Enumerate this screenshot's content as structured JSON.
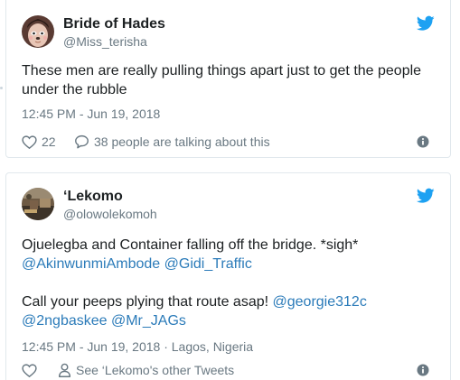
{
  "tweets": [
    {
      "display_name": "Bride of Hades",
      "handle": "@Miss_terisha",
      "text": "These men are really pulling things apart just to get the people under the rubble",
      "timestamp": "12:45 PM - Jun 19, 2018",
      "like_count": "22",
      "reply_label": "38 people are talking about this"
    },
    {
      "display_name": "‘Lekomo",
      "handle": "@olowolekomoh",
      "line1_text": "Ojuelegba and Container falling off the bridge. *sigh*",
      "line2_mention1": "@AkinwunmiAmbode",
      "line2_mention2": "@Gidi_Traffic",
      "line3_text": "Call your peeps plying that route asap!",
      "line3_mention": "@georgie312c",
      "line4_mention1": "@2ngbaskee",
      "line4_mention2": "@Mr_JAGs",
      "timestamp": "12:45 PM - Jun 19, 2018 · Lagos, Nigeria",
      "profile_label": "See ‘Lekomo's other Tweets"
    }
  ],
  "icons": {
    "brand": "twitter-bird-icon",
    "like": "heart-icon",
    "reply": "speech-bubble-icon",
    "profile": "person-icon",
    "info": "info-icon"
  },
  "colors": {
    "twitter_blue": "#1da1f2",
    "link_blue": "#2b7bb9",
    "meta_gray": "#697882",
    "text": "#1c2022",
    "border": "#e1e8ed"
  }
}
